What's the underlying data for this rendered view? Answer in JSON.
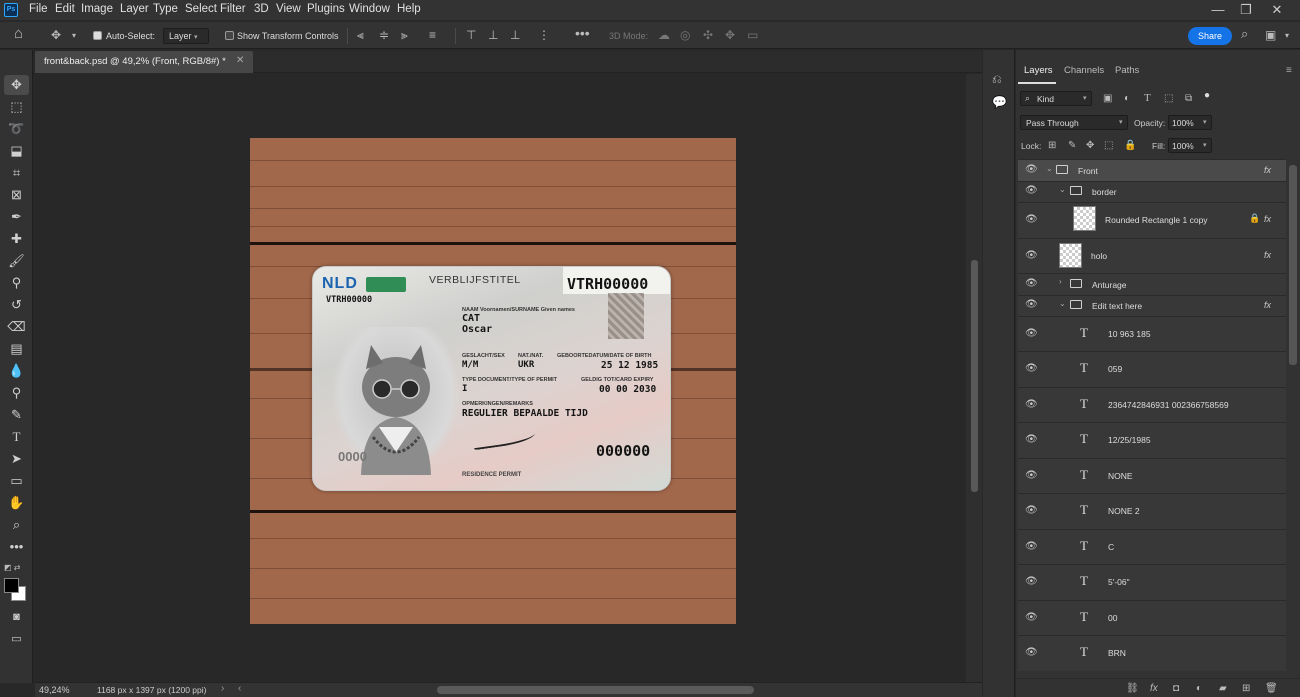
{
  "menubar": {
    "app_logo": "Ps",
    "items": [
      "File",
      "Edit",
      "Image",
      "Layer",
      "Type",
      "Select",
      "Filter",
      "3D",
      "View",
      "Plugins",
      "Window",
      "Help"
    ]
  },
  "options": {
    "auto_select_label": "Auto-Select:",
    "auto_select_checked": true,
    "auto_select_target": "Layer",
    "show_transform_label": "Show Transform Controls",
    "show_transform_checked": false,
    "three_d_mode_label": "3D Mode:",
    "share_label": "Share"
  },
  "document": {
    "tab_title": "front&back.psd @ 49,2% (Front, RGB/8#) *",
    "zoom": "49,24%",
    "size": "1168 px x 1397 px (1200 ppi)"
  },
  "card": {
    "country": "NLD",
    "title": "VERBLIJFSTITEL",
    "doc_number": "VTRH00000",
    "doc_number_small": "VTRH00000",
    "name_label": "NAAM Voornamen/SURNAME Given names",
    "surname": "CAT",
    "given_name": "Oscar",
    "sex_label": "GESLACHT/SEX",
    "nat_label": "NAT./NAT.",
    "dob_label": "GEBOORTEDATUM/DATE OF BIRTH",
    "sex": "M/M",
    "nationality": "UKR",
    "dob": "25 12 1985",
    "type_label": "TYPE DOCUMENT/TYPE OF PERMIT",
    "expiry_label": "GELDIG TOT/CARD EXPIRY",
    "type": "I",
    "expiry": "00 00 2030",
    "remarks_label": "OPMERKINGEN/REMARKS",
    "remarks": "REGULIER BEPAALDE TIJD",
    "number_big": "000000",
    "footer": "RESIDENCE PERMIT",
    "kinegram_text": "0000"
  },
  "layers_panel": {
    "tabs": [
      "Layers",
      "Channels",
      "Paths"
    ],
    "active_tab": "Layers",
    "filter_kind": "Kind",
    "blend_mode": "Pass Through",
    "opacity_label": "Opacity:",
    "opacity": "100%",
    "lock_label": "Lock:",
    "fill_label": "Fill:",
    "fill": "100%",
    "layers": [
      {
        "name": "Front",
        "kind": "group",
        "fx": true,
        "selected": true
      },
      {
        "name": "border",
        "kind": "group",
        "fx": false
      },
      {
        "name": "Rounded Rectangle 1 copy",
        "kind": "shape",
        "fx": true,
        "locked": true
      },
      {
        "name": "holo",
        "kind": "pixel",
        "fx": true
      },
      {
        "name": "Anturage",
        "kind": "group",
        "fx": false
      },
      {
        "name": "Edit text here",
        "kind": "group",
        "fx": true
      },
      {
        "name": "10 963 185",
        "kind": "text"
      },
      {
        "name": "059",
        "kind": "text"
      },
      {
        "name": "2364742846931 002366758569",
        "kind": "text"
      },
      {
        "name": "12/25/1985",
        "kind": "text"
      },
      {
        "name": "NONE",
        "kind": "text"
      },
      {
        "name": "NONE 2",
        "kind": "text"
      },
      {
        "name": "C",
        "kind": "text"
      },
      {
        "name": "5'-06\"",
        "kind": "text"
      },
      {
        "name": "00",
        "kind": "text"
      },
      {
        "name": "BRN",
        "kind": "text"
      }
    ]
  },
  "colors": {
    "accent": "#1473e6",
    "wood": "#a2684c",
    "panel": "#323232"
  }
}
